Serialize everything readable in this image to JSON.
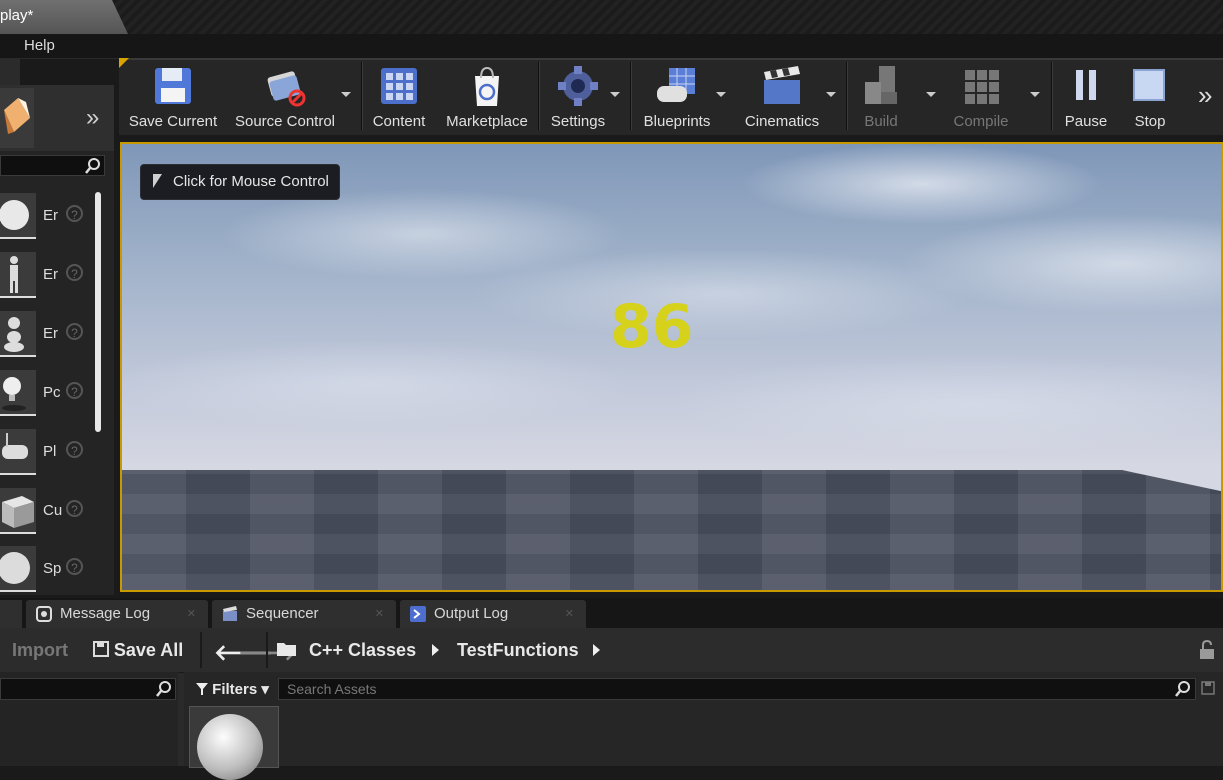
{
  "window": {
    "tab_title": "play*"
  },
  "menu": {
    "items": [
      "Help"
    ]
  },
  "place_panel": {
    "items": [
      {
        "label": "Er",
        "icon": "sphere-icon"
      },
      {
        "label": "Er",
        "icon": "character-icon"
      },
      {
        "label": "Er",
        "icon": "pawn-icon"
      },
      {
        "label": "Pc",
        "icon": "light-bulb-icon"
      },
      {
        "label": "Pl",
        "icon": "player-start-icon"
      },
      {
        "label": "Cu",
        "icon": "cube-icon"
      },
      {
        "label": "Sp",
        "icon": "sphere-icon"
      }
    ],
    "help_glyph": "?"
  },
  "toolbar": {
    "save_current": "Save Current",
    "source_control": "Source Control",
    "content": "Content",
    "marketplace": "Marketplace",
    "settings": "Settings",
    "blueprints": "Blueprints",
    "cinematics": "Cinematics",
    "build": "Build",
    "compile": "Compile",
    "pause": "Pause",
    "stop": "Stop",
    "overflow": "»"
  },
  "viewport": {
    "mouse_hint": "Click for Mouse Control",
    "score": "86"
  },
  "bottom_tabs": [
    {
      "label": "Message Log"
    },
    {
      "label": "Sequencer"
    },
    {
      "label": "Output Log"
    }
  ],
  "content_browser": {
    "import": "Import",
    "save_all": "Save All",
    "path": [
      "C++ Classes",
      "TestFunctions"
    ],
    "filters": "Filters",
    "search_placeholder": "Search Assets"
  },
  "colors": {
    "accent": "#c89a00",
    "score": "#d6d21c"
  }
}
